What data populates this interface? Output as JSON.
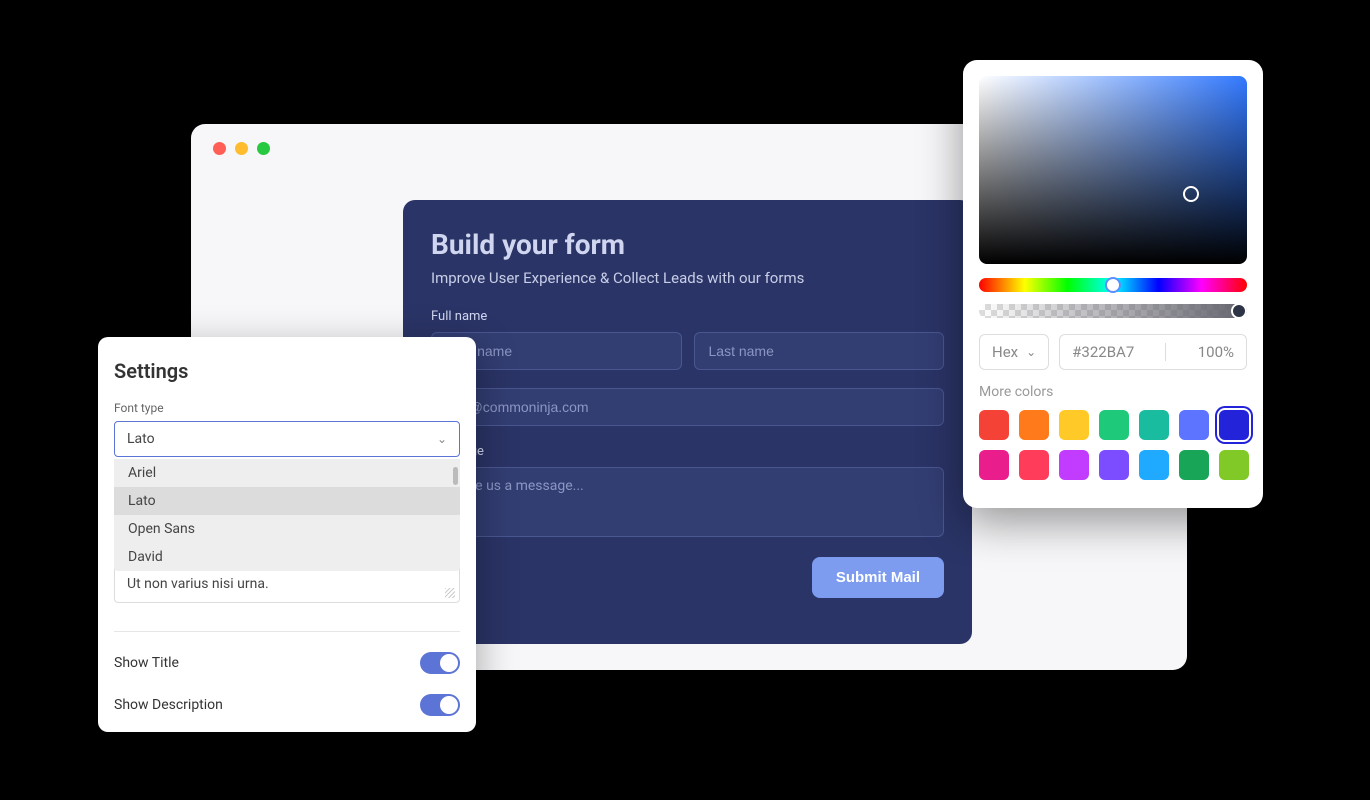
{
  "browser": {},
  "form": {
    "title": "Build your form",
    "subtitle": "Improve User Experience & Collect Leads with our forms",
    "fullname_label": "Full name",
    "first_name_placeholder": "First name",
    "last_name_placeholder": "Last name",
    "email_placeholder": "you@commoninja.com",
    "message_label": "Message",
    "message_placeholder": "Leave us a message...",
    "submit_label": "Submit Mail"
  },
  "settings": {
    "title": "Settings",
    "font_type_label": "Font type",
    "font_selected": "Lato",
    "font_options": [
      "Ariel",
      "Lato",
      "Open Sans",
      "David"
    ],
    "preview_text": "Ut non varius nisi urna.",
    "show_title_label": "Show Title",
    "show_description_label": "Show Description",
    "show_title_on": true,
    "show_description_on": true
  },
  "color_picker": {
    "format": "Hex",
    "hex_value": "#322BA7",
    "opacity": "100%",
    "more_colors_label": "More colors",
    "swatches": [
      "#f44336",
      "#ff7a1a",
      "#ffca28",
      "#1fc97a",
      "#1abca0",
      "#5c74ff",
      "#2323d9",
      "#e91e8c",
      "#ff3d5a",
      "#c13cff",
      "#7c4dff",
      "#1fa9ff",
      "#18a558",
      "#80c926"
    ],
    "selected_swatch_index": 6
  }
}
